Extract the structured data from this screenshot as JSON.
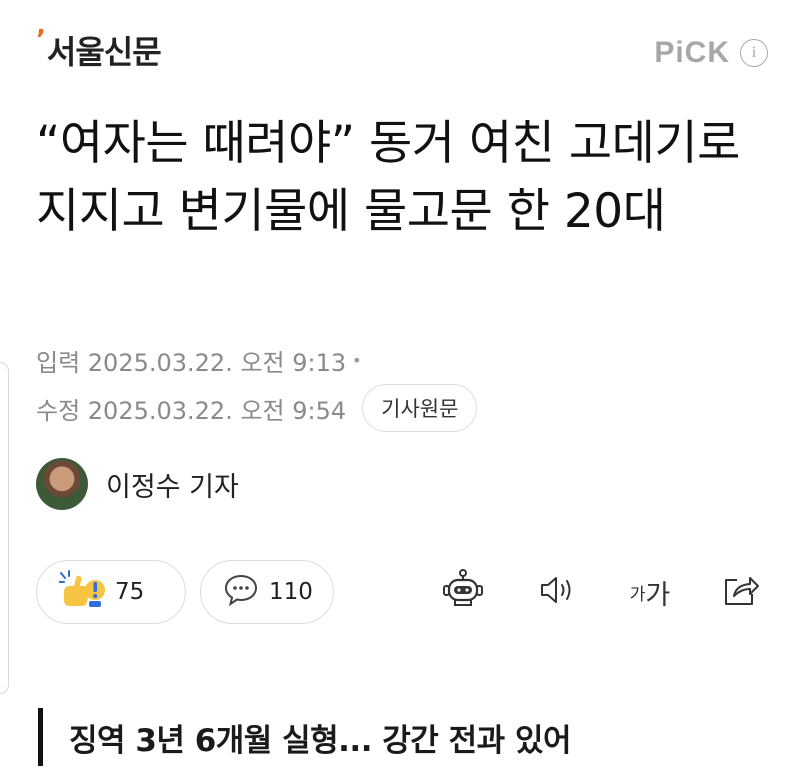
{
  "header": {
    "logo_mark": "’",
    "logo_text": "서울신문",
    "pick_label": "PiCK",
    "info_icon": "i"
  },
  "article": {
    "title": "“여자는 때려야” 동거 여친 고데기로 지지고 변기물에 물고문 한 20대",
    "published": "입력 2025.03.22. 오전 9:13",
    "modified": "수정 2025.03.22. 오전 9:54",
    "original_button": "기사원문",
    "author": "이정수 기자",
    "subheading": "징역 3년 6개월 실형... 강간 전과 있어"
  },
  "actions": {
    "reaction_count": "75",
    "comment_count": "110",
    "font_small": "가",
    "font_large": "가",
    "icons": [
      "reaction-icon",
      "comment-icon",
      "summary-bot-icon",
      "speaker-icon",
      "font-size-icon",
      "share-icon"
    ]
  },
  "colors": {
    "brand_accent": "#f26b1d",
    "muted_text": "#8a8a8a",
    "pick_gray": "#a7a7a7",
    "border": "#dcdcdc"
  }
}
